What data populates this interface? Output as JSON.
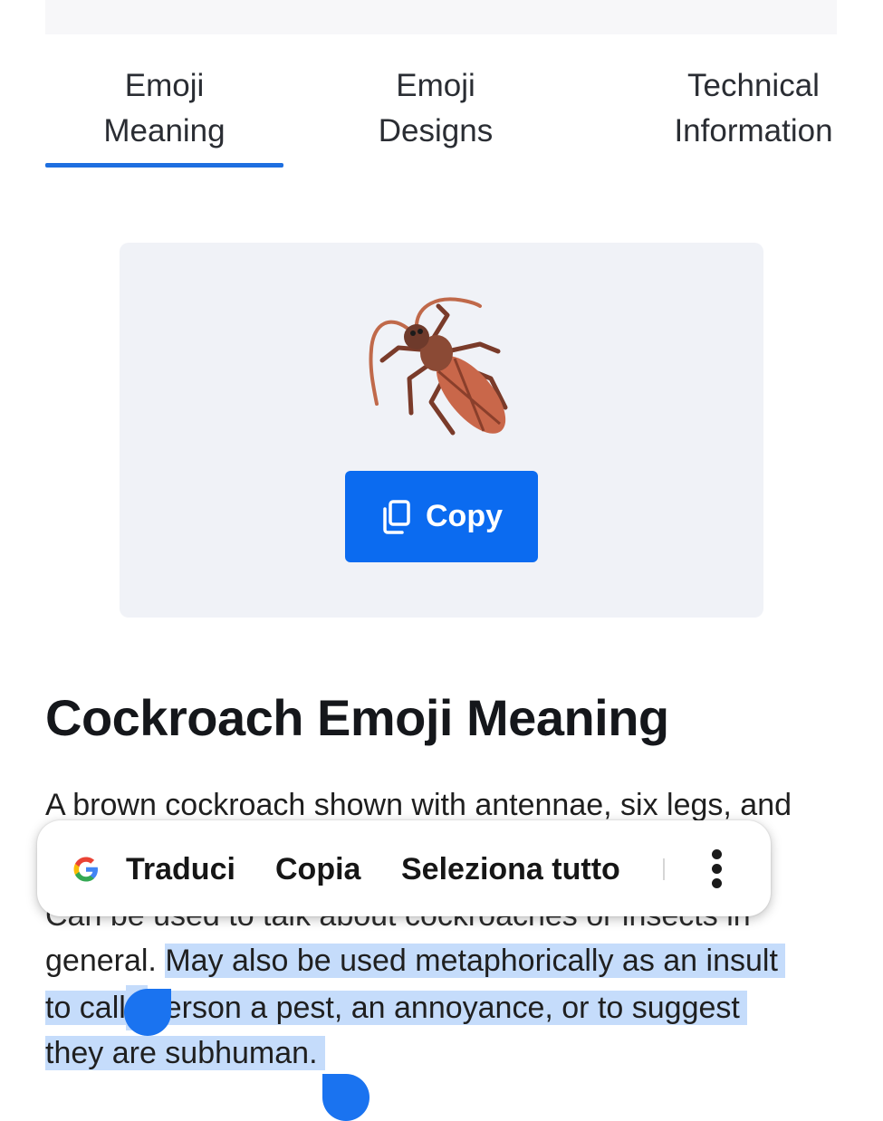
{
  "tabs": [
    {
      "label": "Emoji\nMeaning",
      "active": true
    },
    {
      "label": "Emoji\nDesigns",
      "active": false
    },
    {
      "label": "Technical\nInformation",
      "active": false
    }
  ],
  "emoji_card": {
    "emoji_icon": "cockroach-emoji",
    "copy_label": "Copy"
  },
  "heading": "Cockroach Emoji Meaning",
  "paragraph": {
    "line1": "A brown cockroach shown with antennae, six legs, and",
    "line_hidden": "Can be used to talk about cockroaches or insects in",
    "line2_plain": "general. ",
    "line2_selected": "May also be used metaphorically as an insult",
    "line3_a": "to call",
    "line3_b": "person a pest, an annoyance, or to suggest",
    "line4": "they are subhuman."
  },
  "selection_menu": {
    "translate": "Traduci",
    "copy": "Copia",
    "select_all": "Seleziona tutto",
    "more_icon": "more-vertical-icon",
    "google_icon": "google-g-icon"
  },
  "colors": {
    "accent": "#1e6fe0",
    "copy_button": "#0b6bf0",
    "selection": "#c5dcfb",
    "handle": "#1a73f0"
  }
}
